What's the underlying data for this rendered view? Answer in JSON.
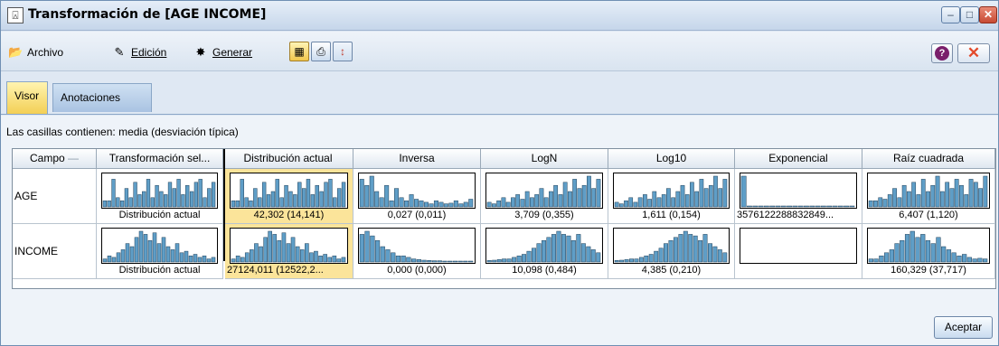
{
  "window": {
    "title": "Transformación de [AGE INCOME]",
    "app_icon": "app-icon",
    "minimize": "–",
    "maximize": "□",
    "close": "✕"
  },
  "toolbar": {
    "archivo": "Archivo",
    "edicion": "Edición",
    "generar": "Generar"
  },
  "tabs": [
    {
      "label": "Visor",
      "active": true
    },
    {
      "label": "Anotaciones",
      "active": false
    }
  ],
  "caption": "Las casillas contienen: media (desviación típica)",
  "grid": {
    "headers": [
      "Campo",
      "Transformación sel...",
      "Distribución actual",
      "Inversa",
      "LogN",
      "Log10",
      "Exponencial",
      "Raíz cuadrada"
    ],
    "rows": [
      {
        "field": "AGE",
        "cells": [
          "Distribución actual",
          "42,302 (14,141)",
          "0,027 (0,011)",
          "3,709 (0,355)",
          "1,611 (0,154)",
          "3576122288832849...",
          "6,407 (1,120)"
        ]
      },
      {
        "field": "INCOME",
        "cells": [
          "Distribución actual",
          "27124,011 (12522,2...",
          "0,000 (0,000)",
          "10,098 (0,484)",
          "4,385 (0,210)",
          "",
          "160,329 (37,717)"
        ]
      }
    ]
  },
  "buttons": {
    "ok": "Aceptar"
  },
  "colors": {
    "histogram_fill": "#5f9ec7",
    "selected_cell": "#fbe49a",
    "active_tab": "#f3cf55"
  }
}
